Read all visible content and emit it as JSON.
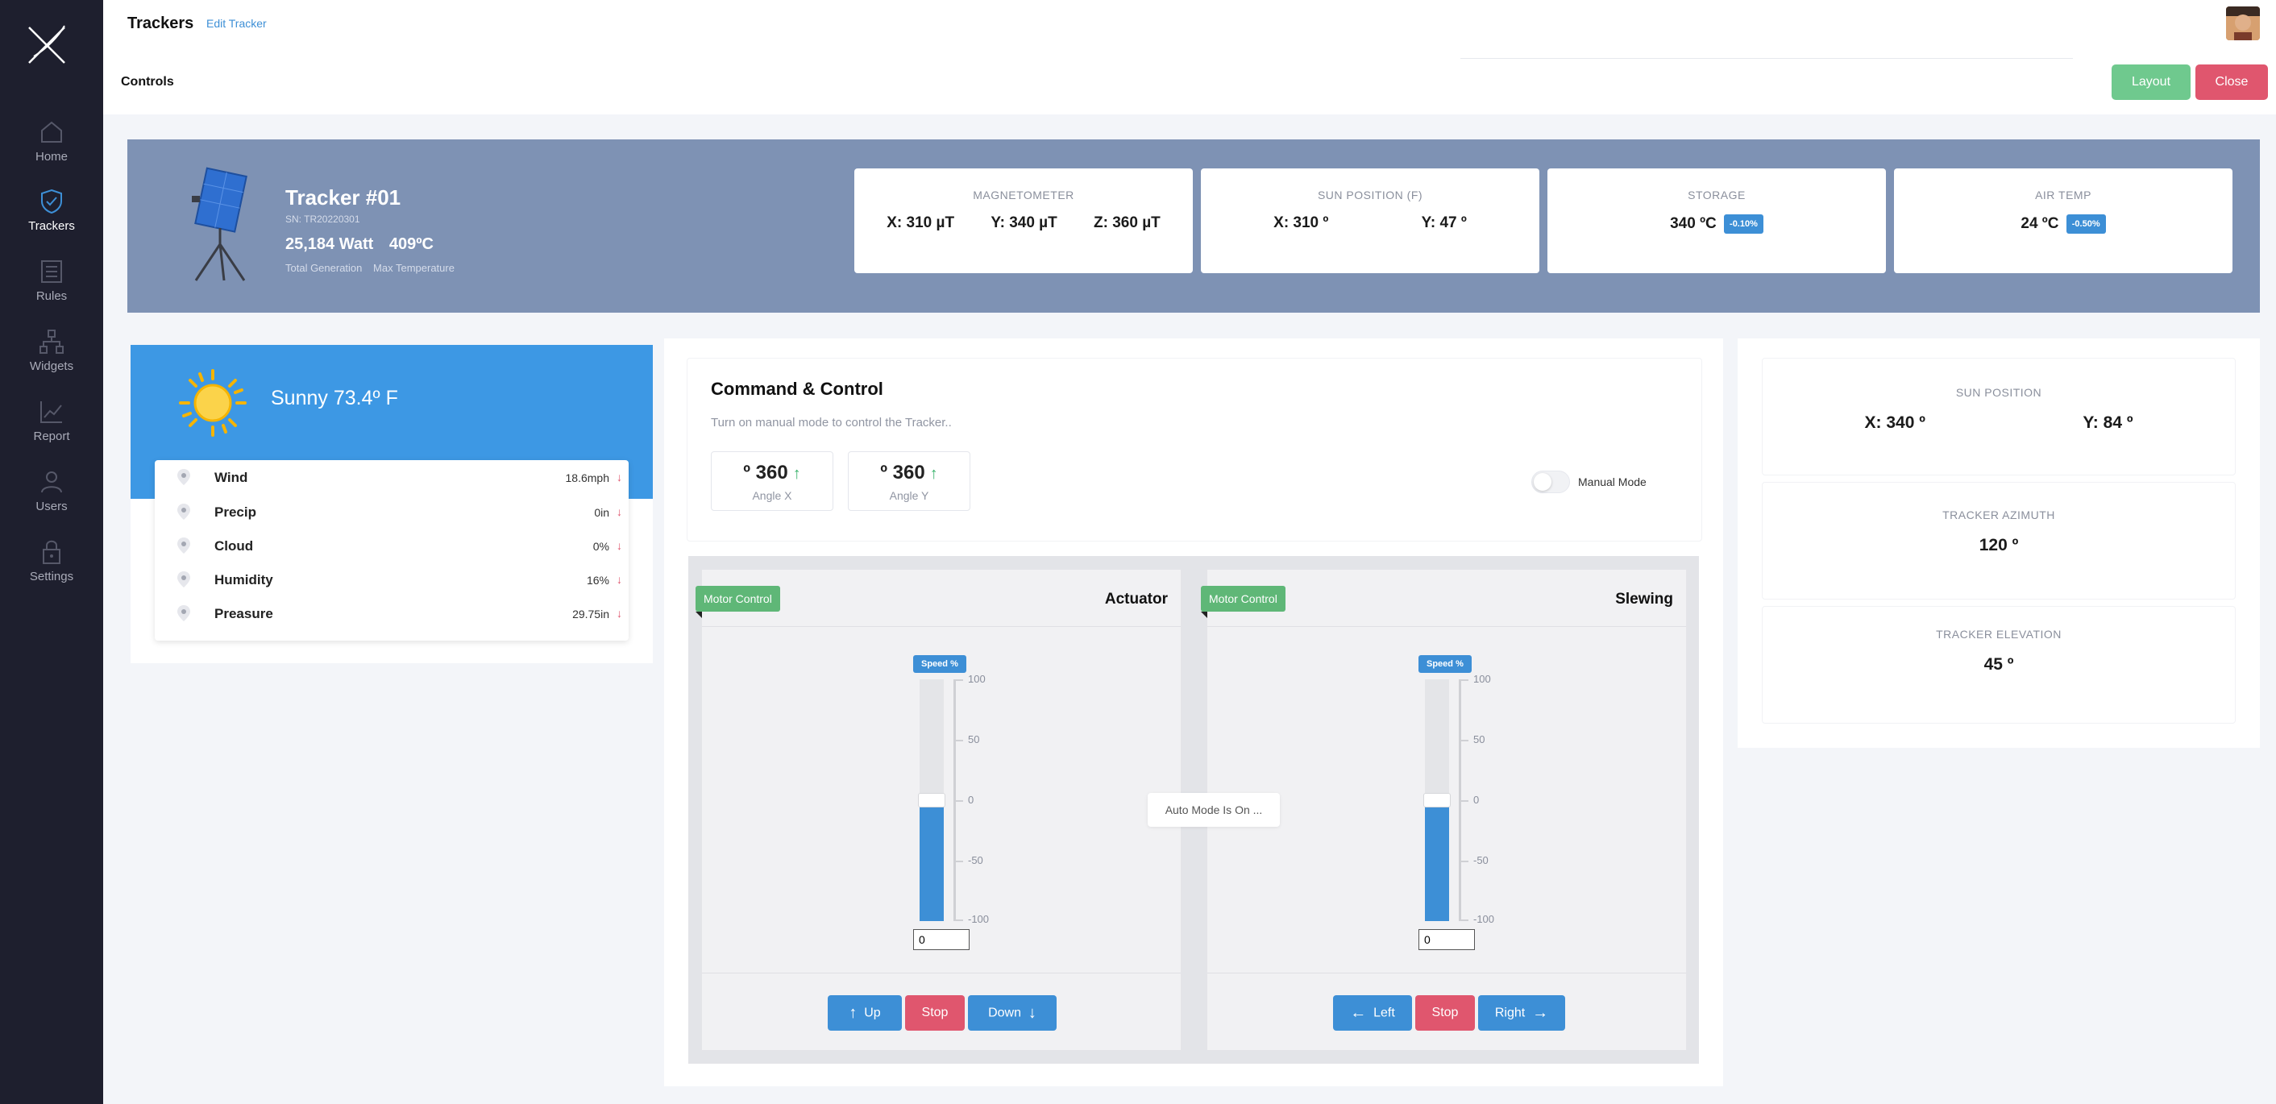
{
  "header": {
    "title": "Trackers",
    "edit_link": "Edit Tracker",
    "section": "Controls",
    "layout_btn": "Layout",
    "close_btn": "Close"
  },
  "sidebar": {
    "items": [
      {
        "label": "Home",
        "icon": "home-icon"
      },
      {
        "label": "Trackers",
        "icon": "shield-icon"
      },
      {
        "label": "Rules",
        "icon": "list-icon"
      },
      {
        "label": "Widgets",
        "icon": "hierarchy-icon"
      },
      {
        "label": "Report",
        "icon": "chart-icon"
      },
      {
        "label": "Users",
        "icon": "user-icon"
      },
      {
        "label": "Settings",
        "icon": "lock-icon"
      }
    ]
  },
  "tracker": {
    "name": "Tracker #01",
    "sn": "SN: TR20220301",
    "generation": "25,184 Watt",
    "max_temp": "409ºC",
    "generation_label": "Total Generation",
    "max_temp_label": "Max Temperature"
  },
  "metrics": {
    "magnetometer": {
      "title": "MAGNETOMETER",
      "x": "X: 310 µT",
      "y": "Y: 340 µT",
      "z": "Z: 360 µT"
    },
    "sun_position": {
      "title": "SUN POSITION (F)",
      "x": "X:  310 º",
      "y": "Y:  47 º"
    },
    "storage": {
      "title": "STORAGE",
      "value": "340 ºC",
      "badge": "-0.10%"
    },
    "air_temp": {
      "title": "AIR TEMP",
      "value": "24 ºC",
      "badge": "-0.50%"
    }
  },
  "weather": {
    "summary": "Sunny  73.4º F",
    "rows": [
      {
        "label": "Wind",
        "value": "18.6mph"
      },
      {
        "label": "Precip",
        "value": "0in"
      },
      {
        "label": "Cloud",
        "value": "0%"
      },
      {
        "label": "Humidity",
        "value": "16%"
      },
      {
        "label": "Preasure",
        "value": "29.75in"
      }
    ]
  },
  "command": {
    "title": "Command & Control",
    "subtitle": "Turn on manual mode to control the Tracker..",
    "angle_x": {
      "value": "º 360",
      "label": "Angle X"
    },
    "angle_y": {
      "value": "º 360",
      "label": "Angle Y"
    },
    "manual_mode_label": "Manual Mode",
    "manual_mode_on": false,
    "auto_mode_text": "Auto Mode Is On ..."
  },
  "motors": {
    "tag": "Motor Control",
    "speed_label": "Speed %",
    "scale": [
      "100",
      "50",
      "0",
      "-50",
      "-100"
    ],
    "actuator": {
      "name": "Actuator",
      "speed": 0,
      "input": "0",
      "btn_up": "Up",
      "btn_stop": "Stop",
      "btn_down": "Down"
    },
    "slewing": {
      "name": "Slewing",
      "speed": 0,
      "input": "0",
      "btn_left": "Left",
      "btn_stop": "Stop",
      "btn_right": "Right"
    }
  },
  "right": {
    "sun_position": {
      "title": "SUN POSITION",
      "x": "X:  340 º",
      "y": "Y:  84 º"
    },
    "azimuth": {
      "title": "TRACKER AZIMUTH",
      "value": "120 º"
    },
    "elevation": {
      "title": "TRACKER ELEVATION",
      "value": "45 º"
    }
  },
  "colors": {
    "sidebar": "#1e1f2e",
    "accent": "#3d8fd6",
    "success": "#6fc98e",
    "danger": "#e0566e",
    "banner": "#7e92b4"
  }
}
